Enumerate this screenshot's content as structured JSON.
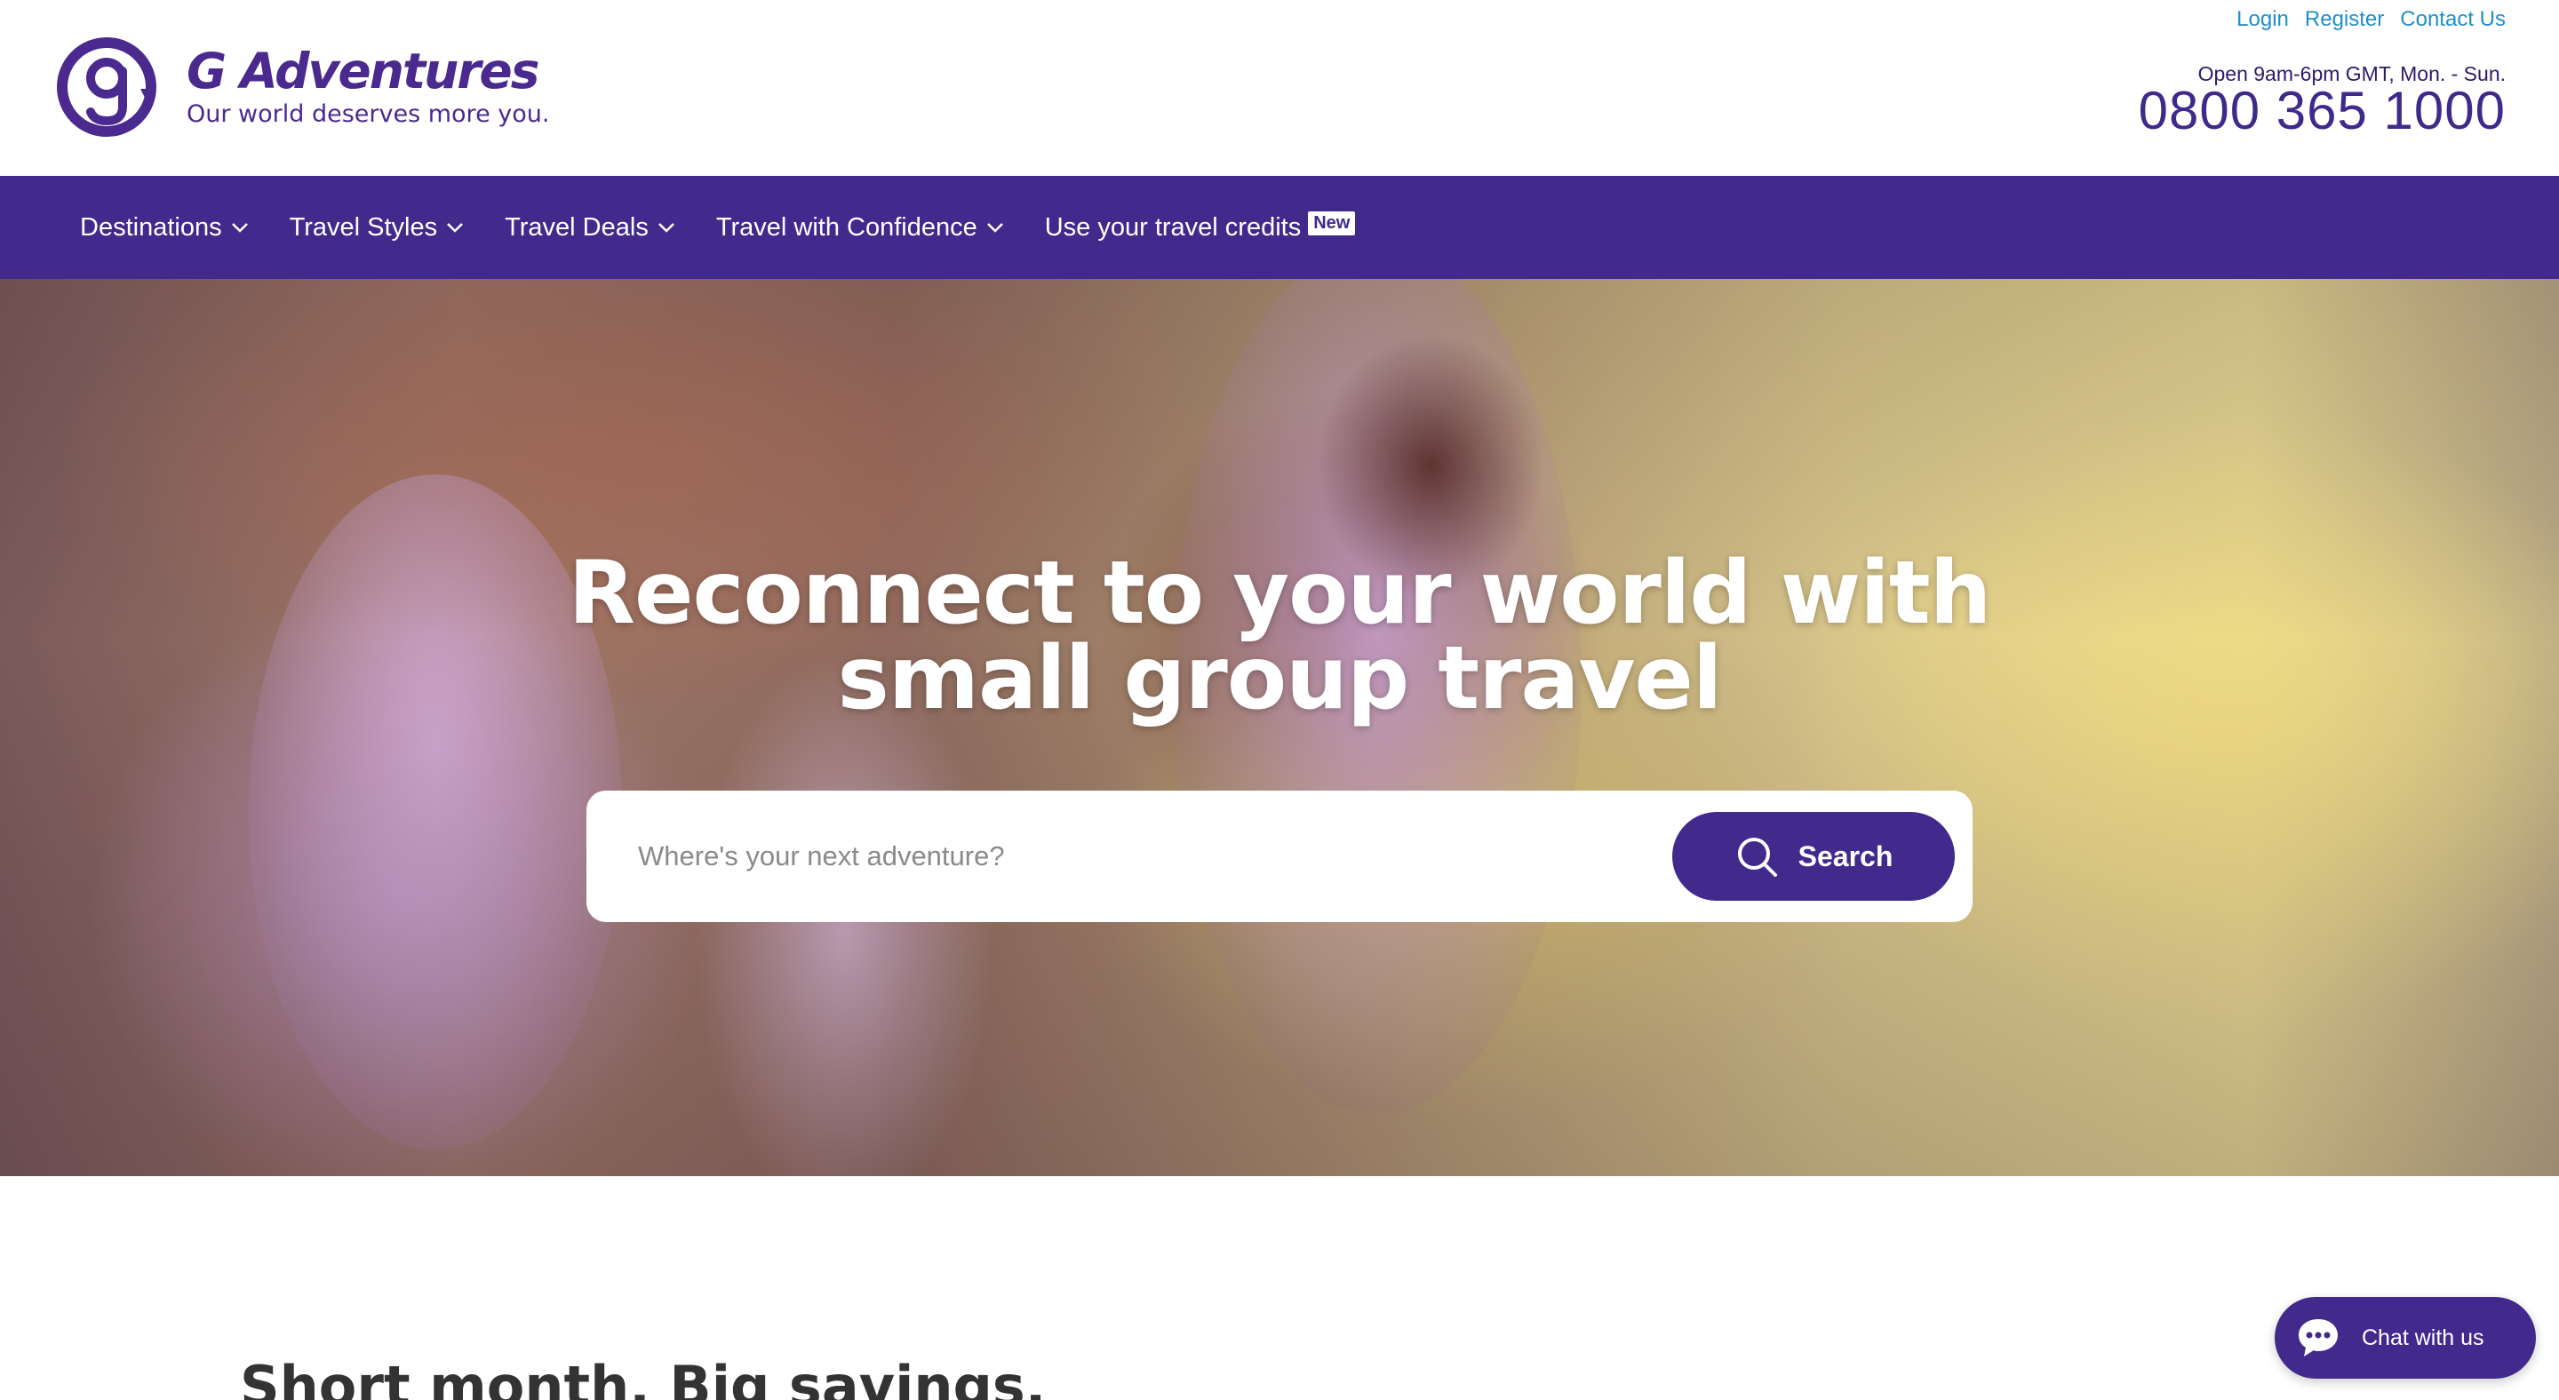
{
  "brand": {
    "name": "G Adventures",
    "tagline": "Our world deserves more you.",
    "color": "#412a8c"
  },
  "utility_links": {
    "login": "Login",
    "register": "Register",
    "contact": "Contact Us"
  },
  "contact": {
    "hours": "Open 9am-6pm GMT, Mon. - Sun.",
    "phone": "0800 365 1000"
  },
  "nav": {
    "items": [
      {
        "label": "Destinations",
        "icon": "chevron-down-icon"
      },
      {
        "label": "Travel Styles",
        "icon": "chevron-down-icon"
      },
      {
        "label": "Travel Deals",
        "icon": "chevron-down-icon"
      },
      {
        "label": "Travel with Confidence",
        "icon": "chevron-down-icon"
      },
      {
        "label": "Use your travel credits",
        "badge": "New"
      }
    ]
  },
  "hero": {
    "title_line1": "Reconnect to your world with",
    "title_line2": "small group travel",
    "search_placeholder": "Where's your next adventure?",
    "search_button": "Search"
  },
  "section": {
    "title": "Short month. Big savings."
  },
  "chat": {
    "label": "Chat with us"
  }
}
